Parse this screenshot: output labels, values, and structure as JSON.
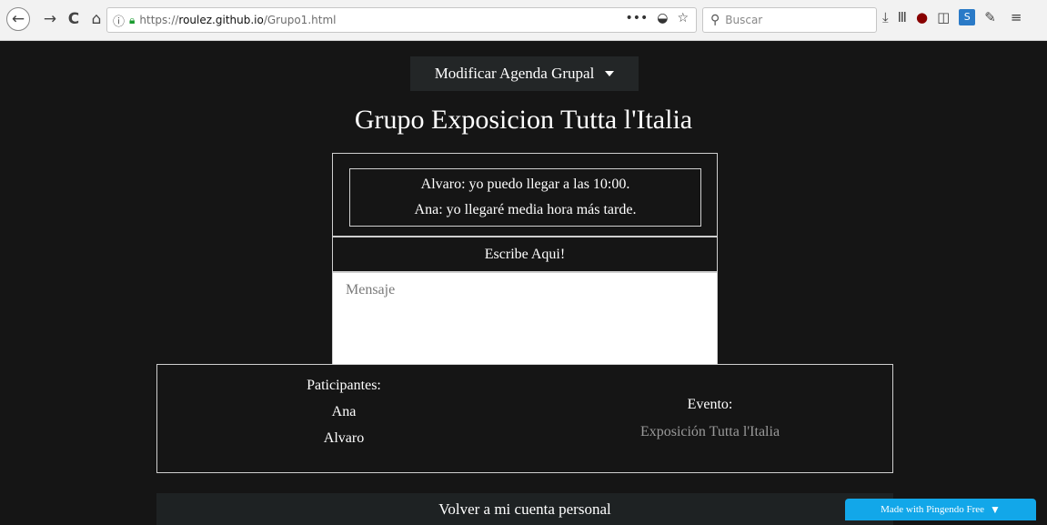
{
  "browser": {
    "url_prefix": "https://",
    "url_domain": "roulez.github.io",
    "url_path": "/Grupo1.html",
    "search_placeholder": "Buscar",
    "back_icon": "←",
    "forward_icon": "→",
    "reload_icon": "C",
    "home_icon": "⌂",
    "more_icon": "•••",
    "pocket_icon": "◒",
    "bookmark_icon": "☆",
    "search_icon": "⚲",
    "download_icon": "⤓",
    "library_icon": "Ⅲ",
    "ublock_icon": "●",
    "sidebar_icon": "◫",
    "s_badge": "S",
    "extension_icon": "✎",
    "menu_icon": "≡"
  },
  "header": {
    "dropdown_label": "Modificar Agenda Grupal",
    "title": "Grupo Exposicion Tutta l'Italia"
  },
  "chat": {
    "messages": [
      "Alvaro: yo puedo llegar a las 10:00.",
      "Ana: yo llegaré media hora más tarde."
    ],
    "write_header": "Escribe Aqui!",
    "input_placeholder": "Mensaje"
  },
  "info": {
    "participants_label": "Paticipantes:",
    "participants": [
      "Ana",
      "Alvaro"
    ],
    "event_label": "Evento:",
    "event_name": "Exposición Tutta l'Italia"
  },
  "footer": {
    "back_button": "Volver a mi cuenta personal",
    "pingendo_badge": "Made with Pingendo Free"
  }
}
